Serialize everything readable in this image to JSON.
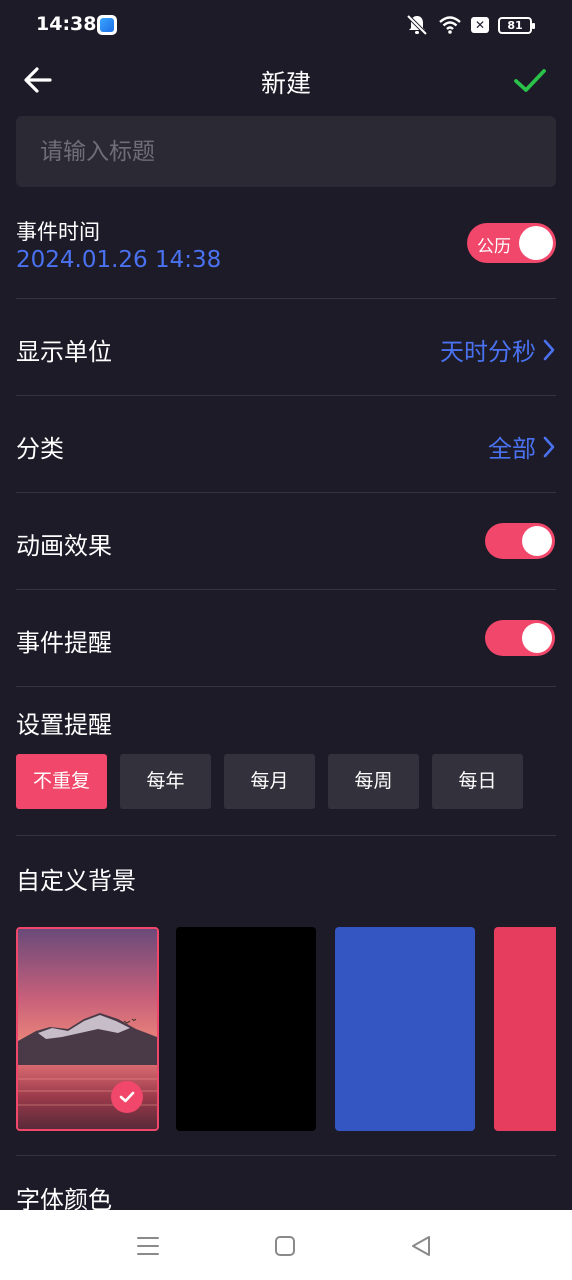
{
  "status_bar": {
    "time": "14:38",
    "battery": "81",
    "icons": [
      "app-badge-icon",
      "mute-icon",
      "wifi-icon",
      "no-sim-icon",
      "battery-icon"
    ]
  },
  "header": {
    "title": "新建",
    "back_icon": "arrow-left-icon",
    "confirm_icon": "check-icon",
    "confirm_color": "#2bc24a"
  },
  "title_input": {
    "placeholder": "请输入标题",
    "value": ""
  },
  "event_time": {
    "label": "事件时间",
    "value": "2024.01.26 14:38",
    "calendar_toggle_label": "公历",
    "calendar_toggle_on": true
  },
  "display_unit": {
    "label": "显示单位",
    "value": "天时分秒"
  },
  "category": {
    "label": "分类",
    "value": "全部"
  },
  "animation": {
    "label": "动画效果",
    "on": true
  },
  "reminder": {
    "label": "事件提醒",
    "on": true
  },
  "repeat": {
    "title": "设置提醒",
    "options": [
      "不重复",
      "每年",
      "每月",
      "每周",
      "每日"
    ],
    "selected": "不重复"
  },
  "background": {
    "title": "自定义背景",
    "options": [
      {
        "name": "sunset-lake-photo",
        "selected": true
      },
      {
        "name": "black",
        "color": "#000000",
        "selected": false
      },
      {
        "name": "blue",
        "color": "#3456c3",
        "selected": false
      },
      {
        "name": "red",
        "color": "#e63c5e",
        "selected": false
      }
    ]
  },
  "font_color": {
    "title": "字体颜色"
  },
  "colors": {
    "accent": "#f0476a",
    "link": "#4a72f0",
    "background": "#1c1b27"
  },
  "nav_bar": {
    "icons": [
      "menu-icon",
      "home-icon",
      "back-triangle-icon"
    ]
  }
}
